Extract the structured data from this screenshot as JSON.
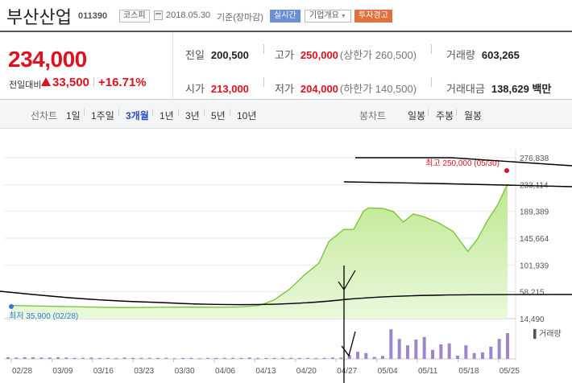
{
  "header": {
    "stock_name": "부산산업",
    "stock_code": "011390",
    "market": "코스피",
    "date": "2018.05.30",
    "basis": "기준(장마감)",
    "btn_realtime": "실시간",
    "btn_company": "기업개요",
    "btn_warning": "투자경고"
  },
  "summary": {
    "price": "234,000",
    "change_label": "전일대비",
    "change_abs": "33,500",
    "change_pct": "+16.71%",
    "prev_close_label": "전일",
    "prev_close": "200,500",
    "high_label": "고가",
    "high": "250,000",
    "high_limit": "(상한가 260,500)",
    "volume_label": "거래량",
    "volume": "603,265",
    "open_label": "시가",
    "open": "213,000",
    "low_label": "저가",
    "low": "204,000",
    "low_limit": "(하한가 140,500)",
    "amount_label": "거래대금",
    "amount": "138,629",
    "amount_unit": "백만"
  },
  "tabs": {
    "line_label": "선차트",
    "line_items": [
      "1일",
      "1주일",
      "3개월",
      "1년",
      "3년",
      "5년",
      "10년"
    ],
    "selected": "3개월",
    "candle_label": "봉차트",
    "candle_items": [
      "일봉",
      "주봉",
      "월봉"
    ]
  },
  "chart_data": {
    "type": "area",
    "y_ticks": [
      "276,838",
      "233,114",
      "189,389",
      "145,664",
      "101,939",
      "58,215",
      "14,490"
    ],
    "x_ticks": [
      "02/28",
      "03/09",
      "03/16",
      "03/23",
      "03/30",
      "04/06",
      "04/13",
      "04/20",
      "04/27",
      "05/04",
      "05/11",
      "05/18",
      "05/25"
    ],
    "ylim": [
      14490,
      276838
    ],
    "high_annotation": "최고 250,000 (05/30)",
    "low_annotation": "최저 35,900 (02/28)",
    "volume_label": "거래량",
    "series": [
      {
        "x": 0,
        "y": 36000
      },
      {
        "x": 6,
        "y": 35000
      },
      {
        "x": 12,
        "y": 34000
      },
      {
        "x": 18,
        "y": 33000
      },
      {
        "x": 24,
        "y": 32500
      },
      {
        "x": 30,
        "y": 33000
      },
      {
        "x": 36,
        "y": 33200
      },
      {
        "x": 42,
        "y": 33000
      },
      {
        "x": 46,
        "y": 33500
      },
      {
        "x": 50,
        "y": 36000
      },
      {
        "x": 53,
        "y": 45000
      },
      {
        "x": 56,
        "y": 62000
      },
      {
        "x": 59,
        "y": 85000
      },
      {
        "x": 62,
        "y": 105000
      },
      {
        "x": 64,
        "y": 140000
      },
      {
        "x": 67,
        "y": 160000
      },
      {
        "x": 69,
        "y": 160000
      },
      {
        "x": 71,
        "y": 190000
      },
      {
        "x": 72,
        "y": 195000
      },
      {
        "x": 75,
        "y": 194000
      },
      {
        "x": 77,
        "y": 189000
      },
      {
        "x": 79,
        "y": 172000
      },
      {
        "x": 81,
        "y": 185000
      },
      {
        "x": 83,
        "y": 181000
      },
      {
        "x": 86,
        "y": 171000
      },
      {
        "x": 89,
        "y": 157000
      },
      {
        "x": 91,
        "y": 135000
      },
      {
        "x": 92,
        "y": 124000
      },
      {
        "x": 94,
        "y": 145000
      },
      {
        "x": 96,
        "y": 175000
      },
      {
        "x": 98,
        "y": 200000
      },
      {
        "x": 100,
        "y": 234000
      }
    ],
    "volume": [
      0.05,
      0.04,
      0.05,
      0.05,
      0.04,
      0.04,
      0.05,
      0.04,
      0.03,
      0.03,
      0.04,
      0.03,
      0.03,
      0.03,
      0.04,
      0.03,
      0.03,
      0.03,
      0.03,
      0.03,
      0.02,
      0.03,
      0.03,
      0.02,
      0.03,
      0.03,
      0.03,
      0.03,
      0.03,
      0.04,
      0.03,
      0.03,
      0.03,
      0.03,
      0.03,
      0.03,
      0.03,
      0.03,
      0.03,
      0.04,
      0.04,
      0.12,
      0.22,
      0.18,
      0.06,
      0.09,
      0.92,
      0.62,
      0.42,
      0.6,
      0.68,
      0.28,
      0.45,
      0.48,
      0.1,
      0.42,
      0.18,
      0.2,
      0.38,
      0.62,
      0.8
    ]
  }
}
